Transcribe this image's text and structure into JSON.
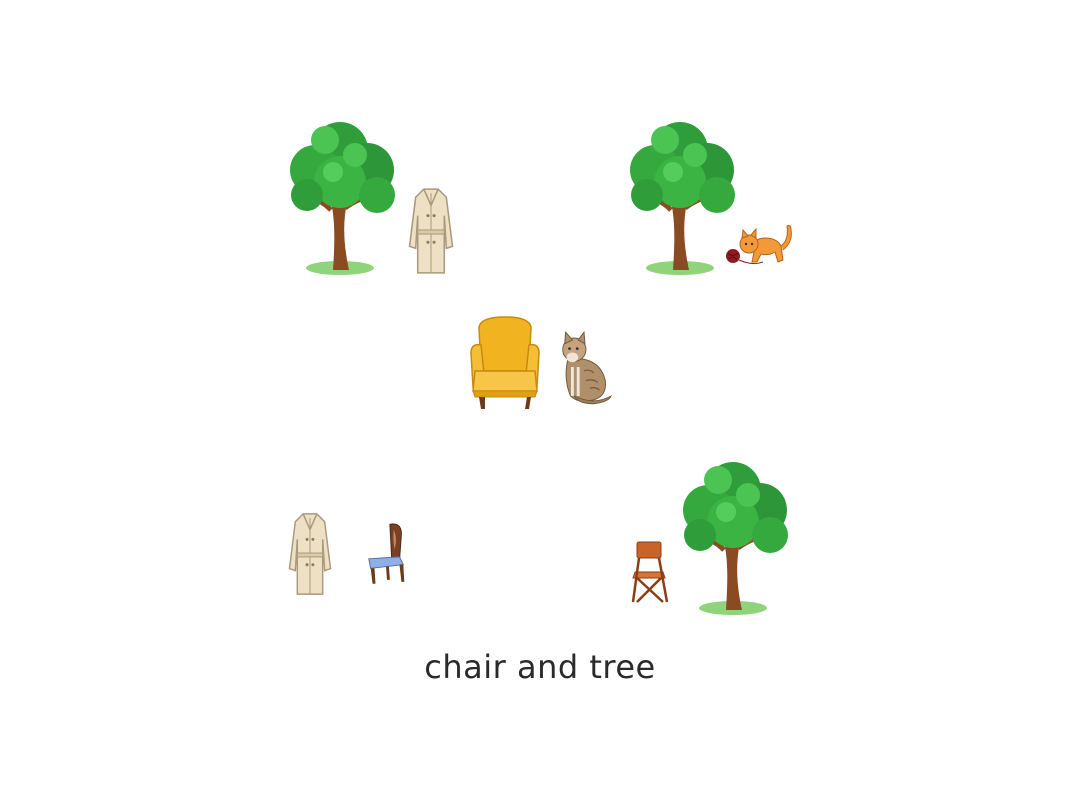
{
  "prompt": {
    "text": "chair and tree"
  },
  "target": {
    "items": [
      "armchair-icon",
      "cat-icon"
    ]
  },
  "options": [
    {
      "id": "top-left",
      "items": [
        "tree-icon",
        "coat-icon"
      ]
    },
    {
      "id": "top-right",
      "items": [
        "tree-icon",
        "cat-with-yarn-icon"
      ]
    },
    {
      "id": "bottom-left",
      "items": [
        "coat-icon",
        "wooden-chair-icon"
      ]
    },
    {
      "id": "bottom-right",
      "items": [
        "folding-chair-icon",
        "tree-icon"
      ]
    }
  ],
  "colors": {
    "tree_leaves": "#2f9e3a",
    "tree_trunk": "#8a4b22",
    "armchair": "#f2b320",
    "coat": "#ede0c4",
    "cat_tabby": "#b08f6a",
    "cat_orange": "#f29a3a",
    "folding_chair": "#c8642a",
    "chair_seat": "#8fb0e6",
    "text": "#2a2a2a"
  }
}
